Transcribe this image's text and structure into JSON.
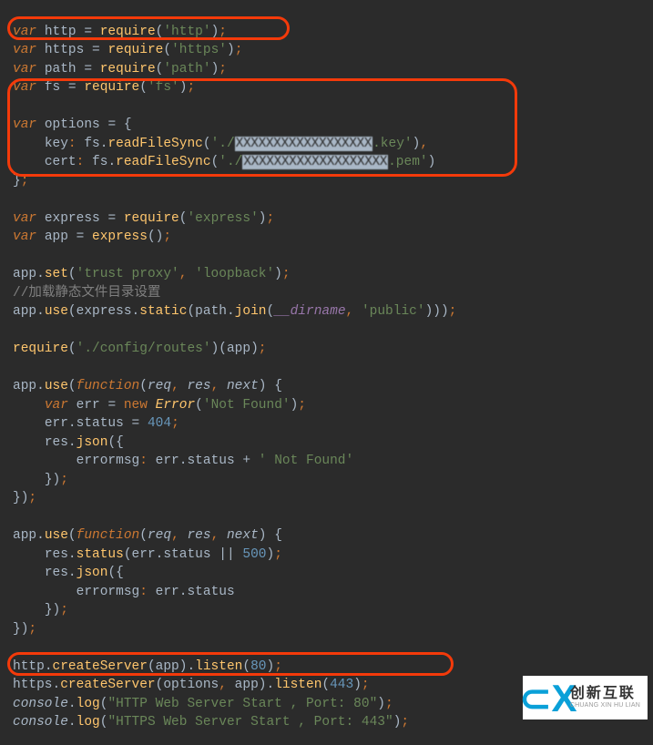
{
  "lines": {
    "l1": {
      "kw": "var",
      "name": "http",
      "req": "require",
      "mod": "'http'"
    },
    "l2": {
      "kw": "var",
      "name": "https",
      "req": "require",
      "mod": "'https'"
    },
    "l3": {
      "kw": "var",
      "name": "path",
      "req": "require",
      "mod": "'path'"
    },
    "l4": {
      "kw": "var",
      "name": "fs",
      "req": "require",
      "mod": "'fs'"
    },
    "l6": {
      "kw": "var",
      "name": "options"
    },
    "l7": {
      "key": "key",
      "fs": "fs",
      "fn": "readFileSync",
      "s1": "'./",
      "ob": "XXXXXXXXXXXXXXXXXX",
      "s2": ".key'"
    },
    "l8": {
      "cert": "cert",
      "fs": "fs",
      "fn": "readFileSync",
      "s1": "'./",
      "ob": "XXXXXXXXXXXXXXXXXXX",
      "s2": ".pem'"
    },
    "l11": {
      "kw": "var",
      "name": "express",
      "req": "require",
      "mod": "'express'"
    },
    "l12": {
      "kw": "var",
      "name": "app",
      "rhs": "express"
    },
    "l14": {
      "app": "app",
      "fn": "set",
      "a": "'trust proxy'",
      "b": "'loopback'"
    },
    "l15": {
      "cmt": "//加载静态文件目录设置"
    },
    "l16": {
      "app": "app",
      "use": "use",
      "express": "express",
      "static": "static",
      "path": "path",
      "join": "join",
      "dir": "__dirname",
      "pub": "'public'"
    },
    "l18": {
      "req": "require",
      "mod": "'./config/routes'",
      "arg": "app"
    },
    "l20": {
      "app": "app",
      "use": "use",
      "fn": "function",
      "p1": "req",
      "p2": "res",
      "p3": "next"
    },
    "l21": {
      "kw": "var",
      "name": "err",
      "new": "new",
      "err": "Error",
      "msg": "'Not Found'"
    },
    "l22": {
      "lhs": "err",
      "prop": "status",
      "val": "404"
    },
    "l23": {
      "lhs": "res",
      "fn": "json"
    },
    "l24": {
      "key": "errormsg",
      "a": "err",
      "p": "status",
      "s": "' Not Found'"
    },
    "l28": {
      "app": "app",
      "use": "use",
      "fn": "function",
      "p1": "req",
      "p2": "res",
      "p3": "next"
    },
    "l29": {
      "res": "res",
      "status": "status",
      "err": "err",
      "prop": "status",
      "num": "500"
    },
    "l30": {
      "lhs": "res",
      "fn": "json"
    },
    "l31": {
      "key": "errormsg",
      "a": "err",
      "p": "status"
    },
    "l35": {
      "http": "http",
      "cs": "createServer",
      "arg": "app",
      "listen": "listen",
      "port": "80"
    },
    "l36": {
      "http": "https",
      "cs": "createServer",
      "a1": "options",
      "a2": "app",
      "listen": "listen",
      "port": "443"
    },
    "l37": {
      "c": "console",
      "log": "log",
      "msg": "\"HTTP Web Server Start , Port: 80\""
    },
    "l38": {
      "c": "console",
      "log": "log",
      "msg": "\"HTTPS Web Server Start , Port: 443\""
    }
  },
  "logo": {
    "mark": "⊂X",
    "cn": "创新互联",
    "en": "CHUANG XIN HU LIAN"
  }
}
